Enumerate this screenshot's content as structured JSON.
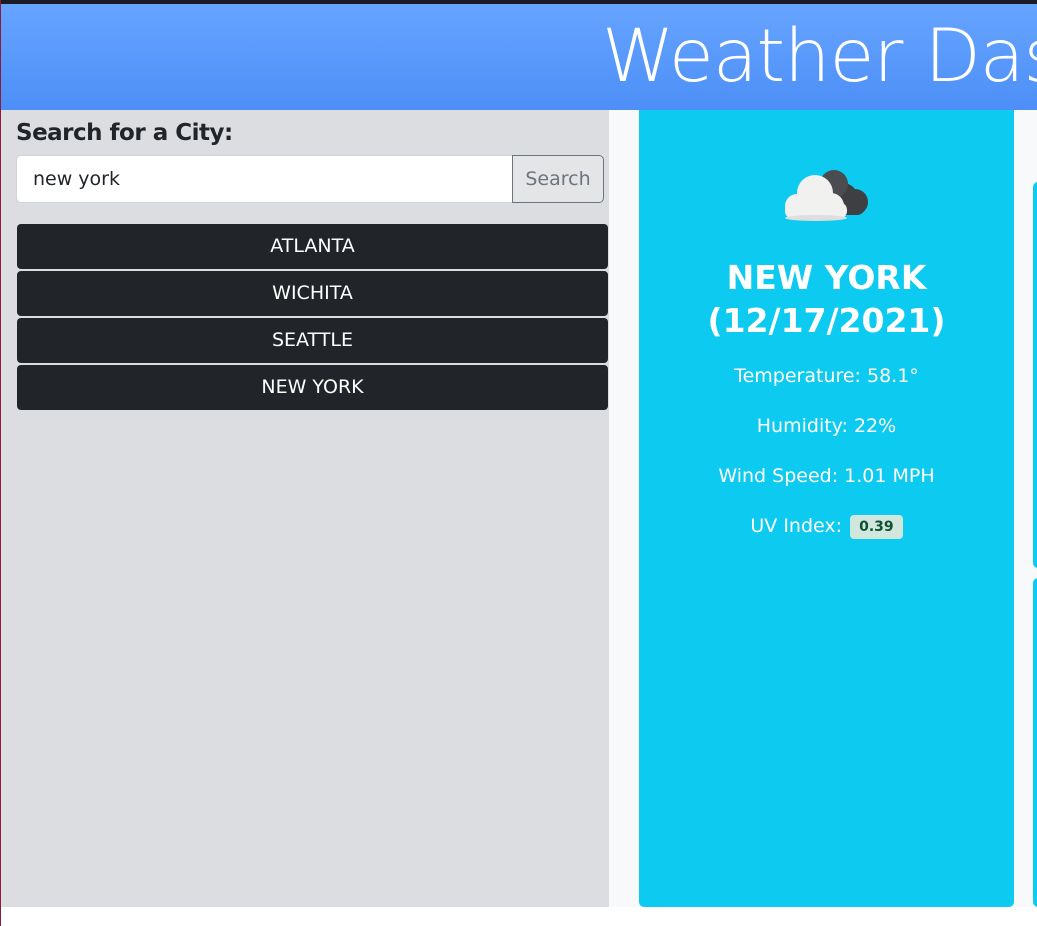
{
  "header": {
    "title": "Weather Dashboard"
  },
  "search": {
    "label": "Search for a City:",
    "value": "new york",
    "button_label": "Search"
  },
  "history": [
    "ATLANTA",
    "WICHITA",
    "SEATTLE",
    "NEW YORK"
  ],
  "current": {
    "icon": "cloudy-icon",
    "city": "NEW YORK",
    "date": "(12/17/2021)",
    "temperature": "Temperature: 58.1°",
    "humidity": "Humidity: 22%",
    "wind": "Wind Speed: 1.01 MPH",
    "uv_label": "UV Index:",
    "uv_value": "0.39"
  },
  "colors": {
    "header": "#5b9bfb",
    "sidebar": "#dcdde0",
    "card": "#0dcaf0",
    "history_button": "#212529",
    "uv_badge": "#d1e7dd"
  }
}
